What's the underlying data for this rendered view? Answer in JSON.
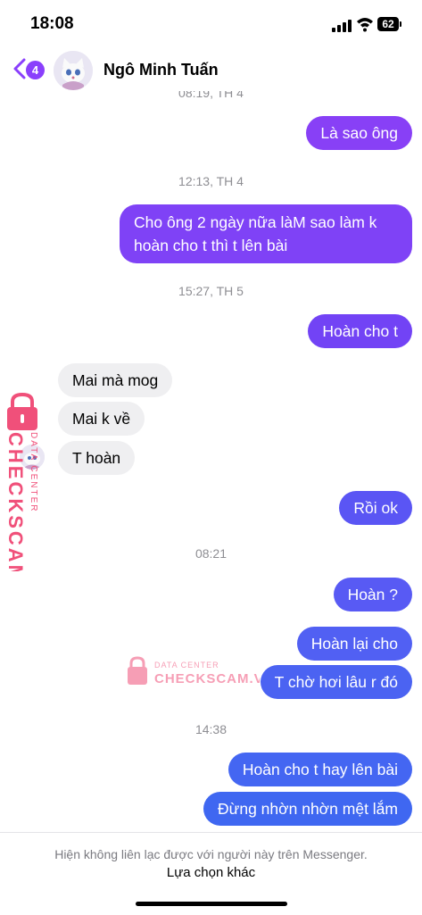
{
  "status_bar": {
    "time": "18:08",
    "battery": "62"
  },
  "header": {
    "back_badge": "4",
    "contact_name": "Ngô Minh Tuấn"
  },
  "colors": {
    "accent": "#8a3ffc",
    "bubble_purple": "#7b3ff4",
    "bubble_blue": "#4a5ff2",
    "incoming": "#efeff1",
    "watermark": "#f0507a"
  },
  "messages": [
    {
      "type": "timestamp",
      "text": "08:19, TH 4"
    },
    {
      "type": "outgoing",
      "text": "Là sao ông"
    },
    {
      "type": "timestamp",
      "text": "12:13, TH 4"
    },
    {
      "type": "outgoing",
      "text": "Cho ông 2 ngày nữa làM sao làm k hoàn cho t thì t lên bài"
    },
    {
      "type": "timestamp",
      "text": "15:27, TH 5"
    },
    {
      "type": "outgoing",
      "text": "Hoàn cho t"
    },
    {
      "type": "incoming",
      "text": "Mai mà mog"
    },
    {
      "type": "incoming",
      "text": "Mai k về"
    },
    {
      "type": "incoming",
      "text": "T hoàn"
    },
    {
      "type": "outgoing",
      "text": "Rồi ok"
    },
    {
      "type": "timestamp",
      "text": "08:21"
    },
    {
      "type": "outgoing",
      "text": "Hoàn ?"
    },
    {
      "type": "outgoing",
      "text": "Hoàn lại cho"
    },
    {
      "type": "outgoing",
      "text": "T chờ hơi lâu r đó"
    },
    {
      "type": "timestamp",
      "text": "14:38"
    },
    {
      "type": "outgoing",
      "text": "Hoàn cho t hay lên bài"
    },
    {
      "type": "outgoing",
      "text": "Đừng nhờn nhờn mệt lắm"
    }
  ],
  "watermark": {
    "caption": "DATA CENTER",
    "brand": "CHECKSCAM.VN"
  },
  "footer": {
    "notice": "Hiện không liên lạc được với người này trên Messenger.",
    "action": "Lựa chọn khác"
  }
}
